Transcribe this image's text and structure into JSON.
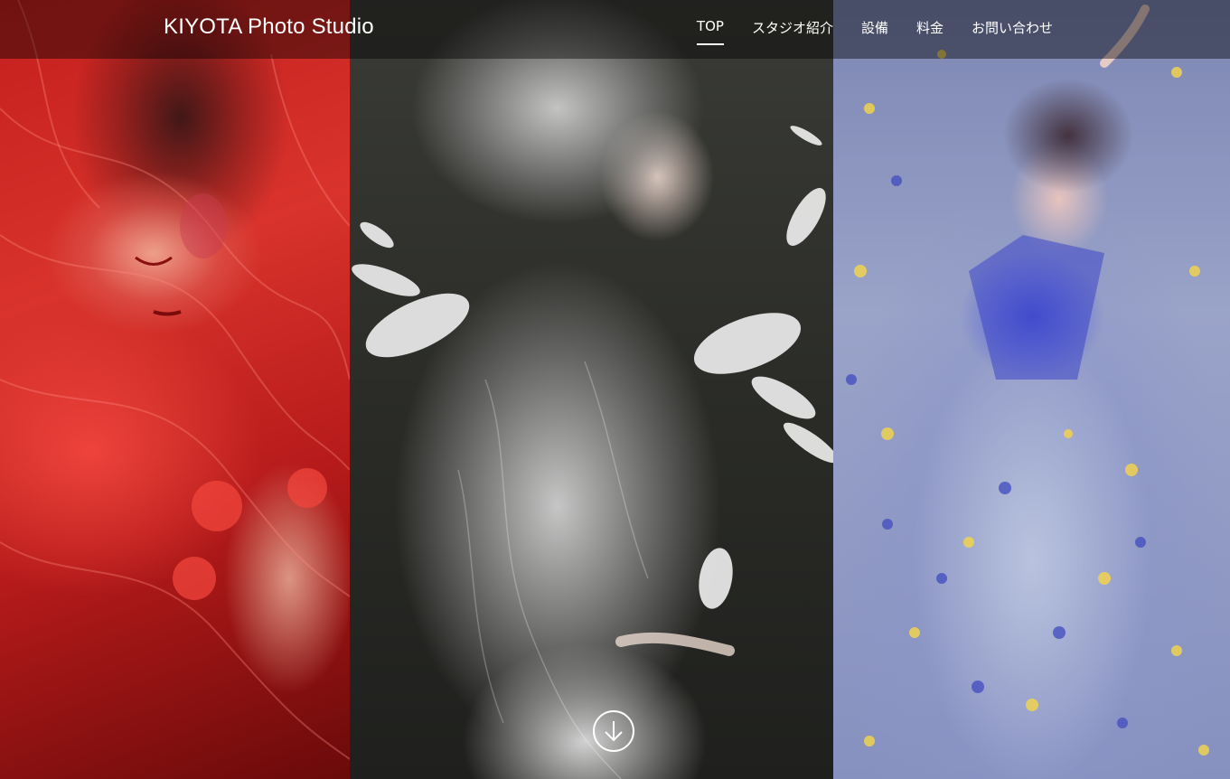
{
  "site": {
    "logo": "KIYOTA Photo Studio"
  },
  "nav": {
    "items": [
      {
        "label": "TOP",
        "active": true
      },
      {
        "label": "スタジオ紹介",
        "active": false
      },
      {
        "label": "設備",
        "active": false
      },
      {
        "label": "料金",
        "active": false
      },
      {
        "label": "お問い合わせ",
        "active": false
      }
    ]
  },
  "hero": {
    "panels": [
      {
        "name": "hero-photo-red",
        "tone": "#c8201c"
      },
      {
        "name": "hero-photo-monochrome",
        "tone": "#2f302c"
      },
      {
        "name": "hero-photo-floral-blue",
        "tone": "#8d97c4"
      }
    ],
    "scroll_icon": "arrow-down-circle-icon"
  },
  "colors": {
    "header_overlay": "rgba(0,0,0,0.42)",
    "text": "#ffffff"
  }
}
